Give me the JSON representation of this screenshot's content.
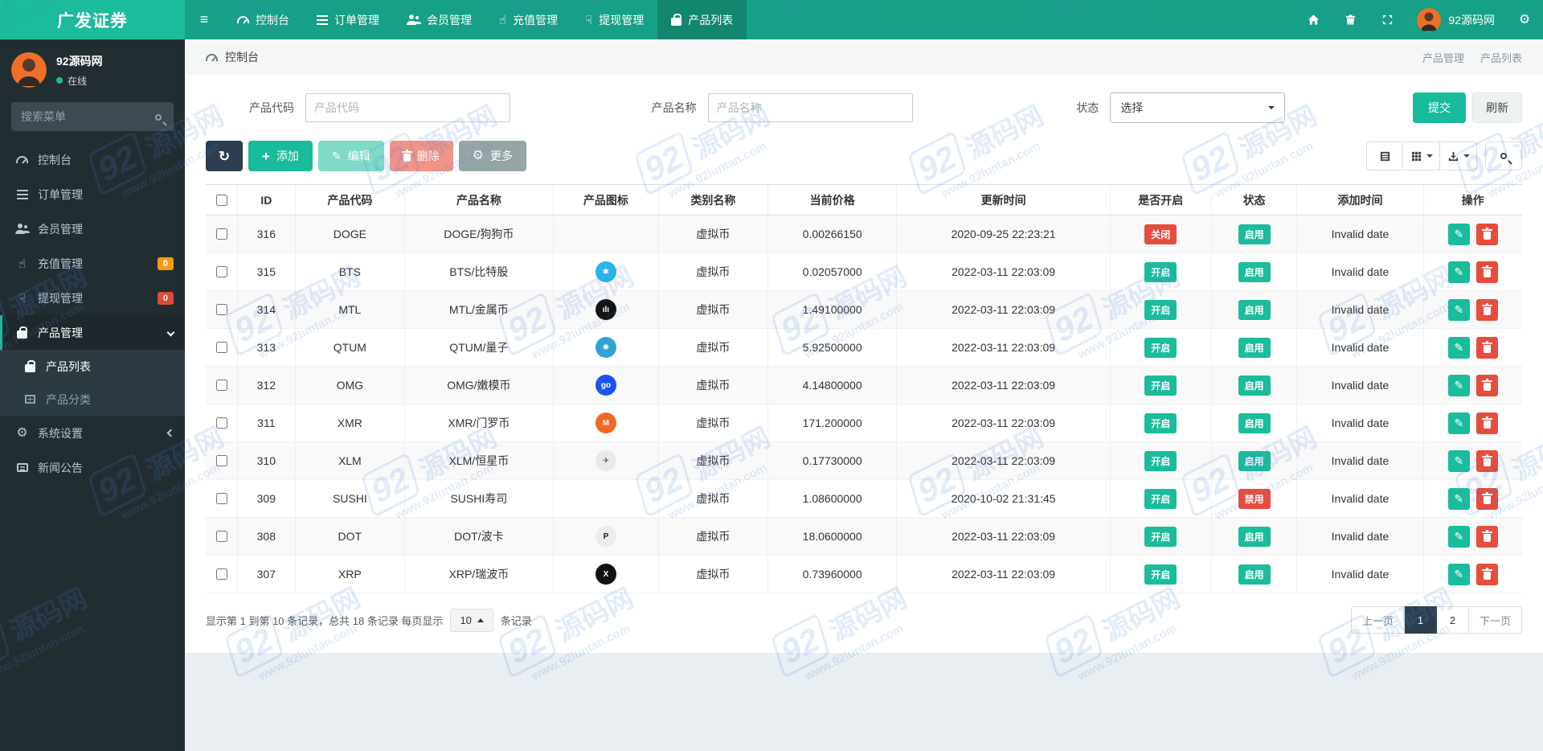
{
  "brand": "广发证券",
  "colors": {
    "accent": "#1abc9c",
    "navbar": "#16a085",
    "sidebar": "#222d32",
    "badge_orange": "#f39c12",
    "badge_red": "#dd4b39",
    "danger": "#e74c3c",
    "dark": "#2c3e50"
  },
  "topnav": {
    "menu": [
      {
        "label": "控制台"
      },
      {
        "label": "订单管理"
      },
      {
        "label": "会员管理"
      },
      {
        "label": "充值管理"
      },
      {
        "label": "提现管理"
      },
      {
        "label": "产品列表",
        "active": true
      }
    ],
    "user": "92源码网"
  },
  "sidebar": {
    "user": {
      "name": "92源码网",
      "status": "在线"
    },
    "search_placeholder": "搜索菜单",
    "menu": [
      {
        "label": "控制台"
      },
      {
        "label": "订单管理"
      },
      {
        "label": "会员管理"
      },
      {
        "label": "充值管理",
        "badge": "0"
      },
      {
        "label": "提现管理",
        "badge": "0"
      },
      {
        "label": "产品管理",
        "active": true
      },
      {
        "label": "产品列表",
        "sub": true,
        "active": true
      },
      {
        "label": "产品分类",
        "sub": true
      },
      {
        "label": "系统设置"
      },
      {
        "label": "新闻公告"
      }
    ]
  },
  "breadcrumb": {
    "left": "控制台",
    "right": [
      "产品管理",
      "产品列表"
    ]
  },
  "filters": {
    "fields": [
      {
        "label": "产品代码",
        "placeholder": "产品代码"
      },
      {
        "label": "产品名称",
        "placeholder": "产品名称"
      },
      {
        "label": "状态",
        "value": "选择"
      }
    ],
    "submit": "提交",
    "refresh": "刷新"
  },
  "toolbar": {
    "add": "添加",
    "edit": "编辑",
    "delete": "删除",
    "more": "更多"
  },
  "table": {
    "columns": [
      "ID",
      "产品代码",
      "产品名称",
      "产品图标",
      "类别名称",
      "当前价格",
      "更新时间",
      "是否开启",
      "状态",
      "添加时间",
      "操作"
    ],
    "rows": [
      {
        "id": "316",
        "code": "DOGE",
        "name": "DOGE/狗狗币",
        "icon": null,
        "category": "虚拟币",
        "price": "0.00266150",
        "updated": "2020-09-25 22:23:21",
        "open": {
          "label": "关闭",
          "cls": "badge-red"
        },
        "status": {
          "label": "启用",
          "cls": "badge-teal"
        },
        "added": "Invalid date"
      },
      {
        "id": "315",
        "code": "BTS",
        "name": "BTS/比特股",
        "icon": {
          "bg": "#28b5e8",
          "glyph": "✱",
          "fg": "#ffffff"
        },
        "category": "虚拟币",
        "price": "0.02057000",
        "updated": "2022-03-11 22:03:09",
        "open": {
          "label": "开启",
          "cls": "badge-teal"
        },
        "status": {
          "label": "启用",
          "cls": "badge-teal"
        },
        "added": "Invalid date"
      },
      {
        "id": "314",
        "code": "MTL",
        "name": "MTL/金属币",
        "icon": {
          "bg": "#141414",
          "glyph": "ılı",
          "fg": "#ffffff"
        },
        "category": "虚拟币",
        "price": "1.49100000",
        "updated": "2022-03-11 22:03:09",
        "open": {
          "label": "开启",
          "cls": "badge-teal"
        },
        "status": {
          "label": "启用",
          "cls": "badge-teal"
        },
        "added": "Invalid date"
      },
      {
        "id": "313",
        "code": "QTUM",
        "name": "QTUM/量子",
        "icon": {
          "bg": "#30a3d4",
          "glyph": "✺",
          "fg": "#ffffff"
        },
        "category": "虚拟币",
        "price": "5.92500000",
        "updated": "2022-03-11 22:03:09",
        "open": {
          "label": "开启",
          "cls": "badge-teal"
        },
        "status": {
          "label": "启用",
          "cls": "badge-teal"
        },
        "added": "Invalid date"
      },
      {
        "id": "312",
        "code": "OMG",
        "name": "OMG/嫩模币",
        "icon": {
          "bg": "#1a53f0",
          "glyph": "go",
          "fg": "#ffffff"
        },
        "category": "虚拟币",
        "price": "4.14800000",
        "updated": "2022-03-11 22:03:09",
        "open": {
          "label": "开启",
          "cls": "badge-teal"
        },
        "status": {
          "label": "启用",
          "cls": "badge-teal"
        },
        "added": "Invalid date"
      },
      {
        "id": "311",
        "code": "XMR",
        "name": "XMR/门罗币",
        "icon": {
          "bg": "#f26822",
          "glyph": "M",
          "fg": "#ffffff"
        },
        "category": "虚拟币",
        "price": "171.200000",
        "updated": "2022-03-11 22:03:09",
        "open": {
          "label": "开启",
          "cls": "badge-teal"
        },
        "status": {
          "label": "启用",
          "cls": "badge-teal"
        },
        "added": "Invalid date"
      },
      {
        "id": "310",
        "code": "XLM",
        "name": "XLM/恒星币",
        "icon": {
          "bg": "#e9e9e9",
          "glyph": "✈",
          "fg": "#555555"
        },
        "category": "虚拟币",
        "price": "0.17730000",
        "updated": "2022-03-11 22:03:09",
        "open": {
          "label": "开启",
          "cls": "badge-teal"
        },
        "status": {
          "label": "启用",
          "cls": "badge-teal"
        },
        "added": "Invalid date"
      },
      {
        "id": "309",
        "code": "SUSHI",
        "name": "SUSHI寿司",
        "icon": null,
        "category": "虚拟币",
        "price": "1.08600000",
        "updated": "2020-10-02 21:31:45",
        "open": {
          "label": "开启",
          "cls": "badge-teal"
        },
        "status": {
          "label": "禁用",
          "cls": "badge-red"
        },
        "added": "Invalid date"
      },
      {
        "id": "308",
        "code": "DOT",
        "name": "DOT/波卡",
        "icon": {
          "bg": "#ececec",
          "glyph": "P",
          "fg": "#1a1a1a"
        },
        "category": "虚拟币",
        "price": "18.0600000",
        "updated": "2022-03-11 22:03:09",
        "open": {
          "label": "开启",
          "cls": "badge-teal"
        },
        "status": {
          "label": "启用",
          "cls": "badge-teal"
        },
        "added": "Invalid date"
      },
      {
        "id": "307",
        "code": "XRP",
        "name": "XRP/瑞波币",
        "icon": {
          "bg": "#111111",
          "glyph": "X",
          "fg": "#ffffff"
        },
        "category": "虚拟币",
        "price": "0.73960000",
        "updated": "2022-03-11 22:03:09",
        "open": {
          "label": "开启",
          "cls": "badge-teal"
        },
        "status": {
          "label": "启用",
          "cls": "badge-teal"
        },
        "added": "Invalid date"
      }
    ]
  },
  "pagination": {
    "summary_prefix": "显示第 1 到第 10 条记录，总共 18 条记录 每页显示",
    "page_size": "10",
    "summary_suffix": "条记录",
    "prev": "上一页",
    "next": "下一页",
    "pages": [
      "1",
      "2"
    ],
    "active_page": "1"
  },
  "watermark": {
    "big": "92",
    "cn": "源码网",
    "url": "www.92luntan.com"
  }
}
